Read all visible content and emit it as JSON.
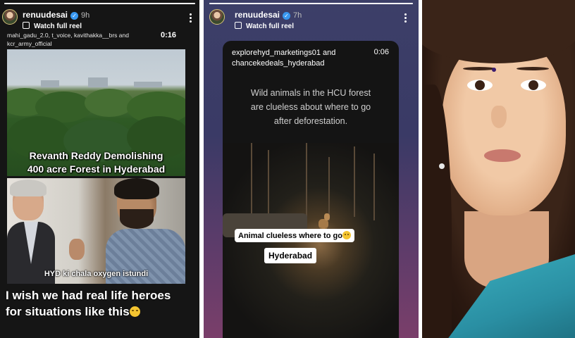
{
  "story1": {
    "username": "renuudesai",
    "time": "9h",
    "watch_label": "Watch full reel",
    "tags": "mahi_gadu_2.0, t_voice, kavithakka__brs and kcr_army_official",
    "duration": "0:16",
    "caption_forest_line1": "Revanth Reddy Demolishing",
    "caption_forest_line2": "400 acre Forest in Hyderabad",
    "caption_scene": "HYD ki chala oxygen istundi",
    "comment_line1": "I wish we had real life heroes",
    "comment_line2": "for situations like this"
  },
  "story2": {
    "username": "renuudesai",
    "time": "7h",
    "watch_label": "Watch full reel",
    "tags_line1": "explorehyd_marketings01 and",
    "tags_line2": "chancekedeals_hyderabad",
    "duration": "0:06",
    "text_line1": "Wild animals in the HCU forest",
    "text_line2": "are clueless about where to go",
    "text_line3": "after deforestation.",
    "sticker_animal": "Animal clueless where to go",
    "sticker_place": "Hyderabad"
  },
  "icons": {
    "verified": "verified-badge-icon",
    "reel": "reel-icon",
    "menu": "more-options-icon",
    "emoji": "disappointed-face-emoji"
  },
  "colors": {
    "verified_blue": "#3897f0",
    "story2_bg": "#3c3f68"
  }
}
